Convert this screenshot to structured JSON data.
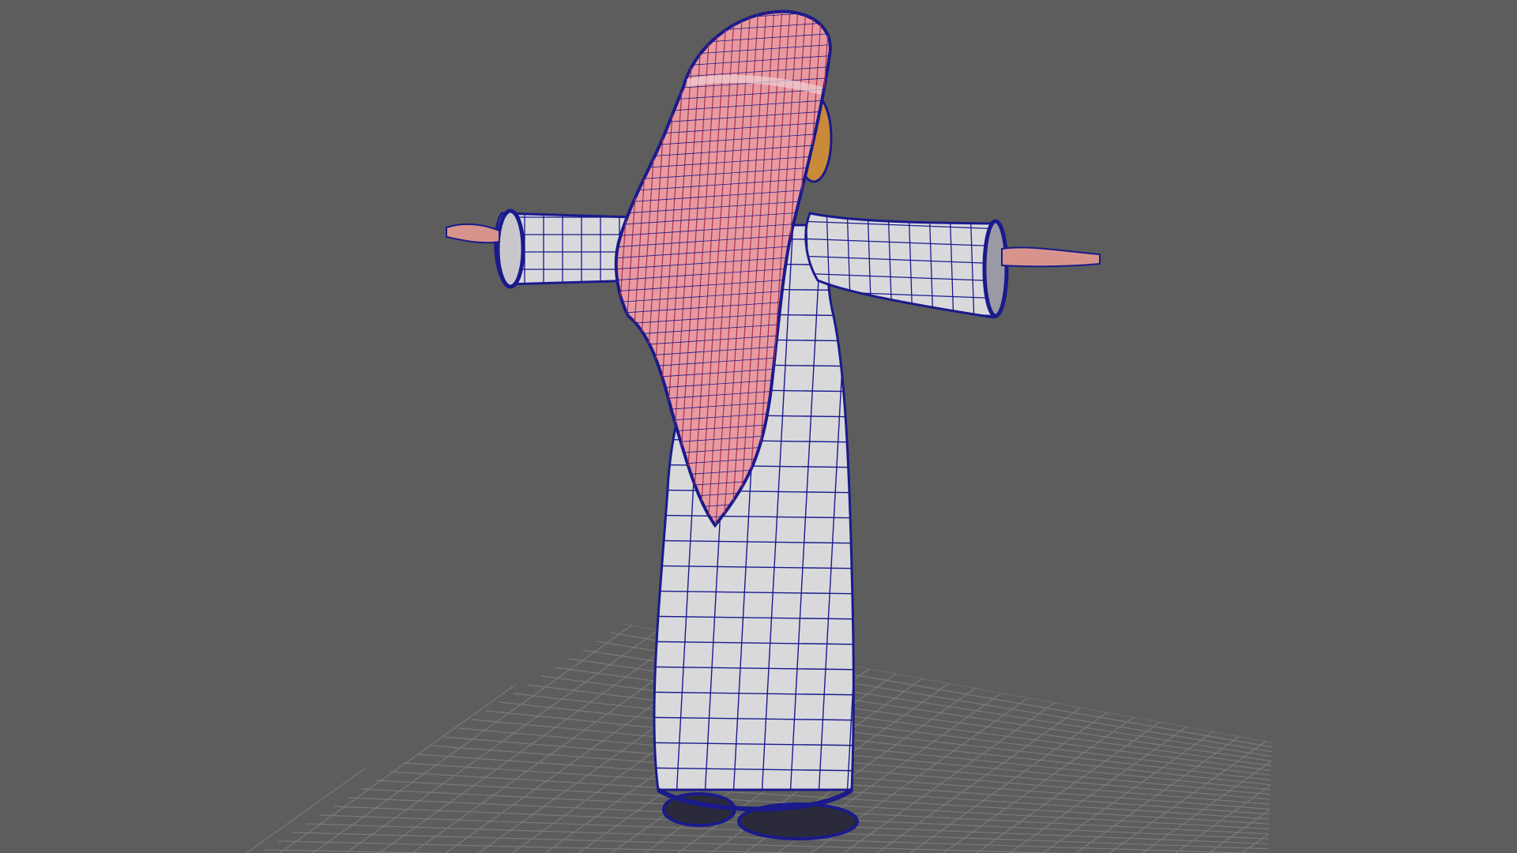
{
  "viewport": {
    "background_color": "#5d5d5d",
    "grid_color": "#7a7a7a",
    "model": {
      "robe_color": "#d9d9dc",
      "robe_shade_color": "#a9aab0",
      "wireframe_color": "#1a1a8c",
      "headscarf_color": "#e79aa2",
      "headscarf_line_color": "#b0304a",
      "face_color": "#c98a3a",
      "shoe_color": "#2a2a3a"
    }
  }
}
